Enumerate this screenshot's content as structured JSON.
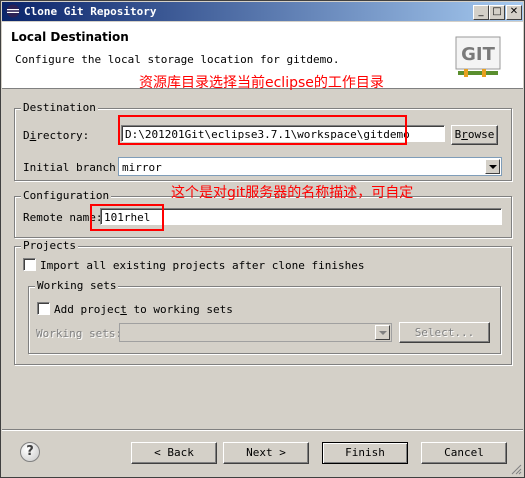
{
  "window": {
    "title": "Clone Git Repository",
    "controls": {
      "minimize": "_",
      "maximize": "□",
      "close": "✕"
    }
  },
  "header": {
    "title": "Local Destination",
    "description": "Configure the local storage location for gitdemo.",
    "annotation": "资源库目录选择当前eclipse的工作目录",
    "logo_text": "GIT"
  },
  "destination": {
    "legend": "Destination",
    "directory_label_pre": "D",
    "directory_label_mnemonic": "i",
    "directory_label_post": "rectory:",
    "directory_value": "D:\\201201Git\\eclipse3.7.1\\workspace\\gitdemo",
    "browse_label_pre": "B",
    "browse_label_mnemonic": "r",
    "browse_label_post": "owse",
    "branch_label": "Initial branch:",
    "branch_value": "mirror"
  },
  "configuration": {
    "legend": "Configuration",
    "annotation": "这个是对git服务器的名称描述，可自定",
    "remote_label": "Remote name:",
    "remote_value": "101rhel"
  },
  "projects": {
    "legend": "Projects",
    "import_label": "Import all existing projects after clone finishes",
    "import_checked": false,
    "working_sets": {
      "legend": "Working sets",
      "add_label_pre": "Add projec",
      "add_label_mnemonic": "t",
      "add_label_post": " to working sets",
      "add_checked": false,
      "sets_label": "Working sets:",
      "select_label": "Select..."
    }
  },
  "footer": {
    "help_label": "?",
    "back_label": "< Back",
    "next_label": "Next >",
    "finish_label": "Finish",
    "cancel_label": "Cancel"
  }
}
